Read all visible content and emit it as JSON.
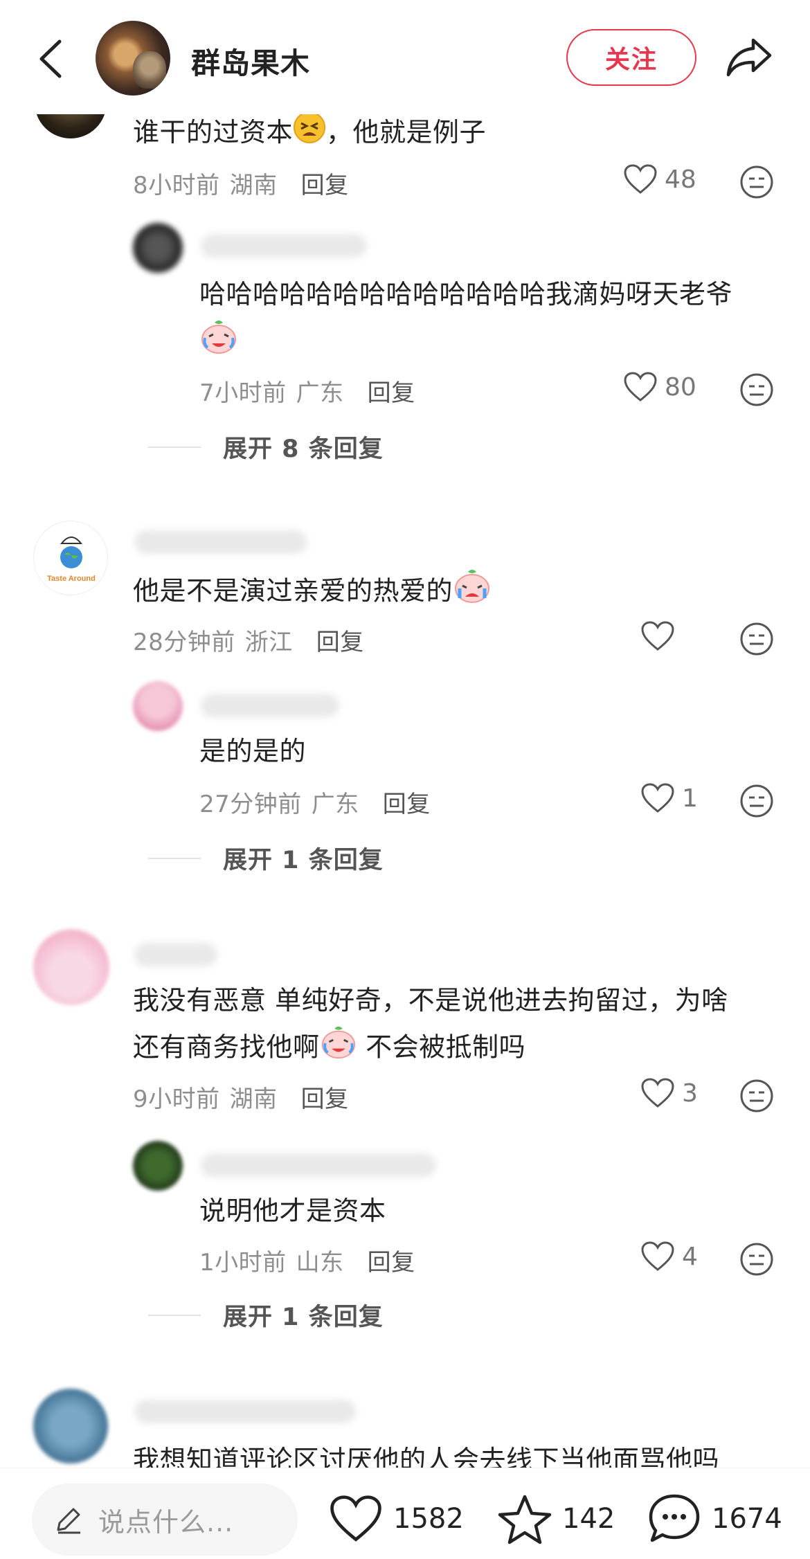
{
  "header": {
    "username": "群岛果木",
    "follow_label": "关注"
  },
  "comments": {
    "c1": {
      "text": "谁干的过资本😫，他就是例子",
      "text_before": "谁干的过资本",
      "text_after": "，他就是例子",
      "time": "8小时前",
      "location": "湖南",
      "reply_label": "回复",
      "likes": "48"
    },
    "c1r1": {
      "text": "哈哈哈哈哈哈哈哈哈哈哈哈哈我滴妈呀天老爷",
      "time": "7小时前",
      "location": "广东",
      "reply_label": "回复",
      "likes": "80"
    },
    "c1_expand": "展开 8 条回复",
    "c2": {
      "text": "他是不是演过亲爱的热爱的",
      "avatar_text": "Taste Around",
      "time": "28分钟前",
      "location": "浙江",
      "reply_label": "回复",
      "likes": ""
    },
    "c2r1": {
      "text": "是的是的",
      "time": "27分钟前",
      "location": "广东",
      "reply_label": "回复",
      "likes": "1"
    },
    "c2_expand": "展开 1 条回复",
    "c3": {
      "line1": "我没有恶意 单纯好奇，不是说他进去拘留过，为啥",
      "line2_before": "还有商务找他啊",
      "line2_after": " 不会被抵制吗",
      "time": "9小时前",
      "location": "湖南",
      "reply_label": "回复",
      "likes": "3"
    },
    "c3r1": {
      "text": "说明他才是资本",
      "time": "1小时前",
      "location": "山东",
      "reply_label": "回复",
      "likes": "4"
    },
    "c3_expand": "展开 1 条回复",
    "c4": {
      "text": "我想知道评论区讨厌他的人会去线下当他面骂他吗"
    }
  },
  "bottom": {
    "input_placeholder": "说点什么...",
    "likes_count": "1582",
    "stars_count": "142",
    "comments_count": "1674"
  },
  "colors": {
    "accent": "#e8364f",
    "meta_gray": "#8e8e8e",
    "text": "#222222"
  },
  "icons": [
    "back-arrow-icon",
    "share-icon",
    "heart-icon",
    "emoji-reaction-icon",
    "pencil-icon",
    "star-icon",
    "comment-bubble-icon"
  ]
}
